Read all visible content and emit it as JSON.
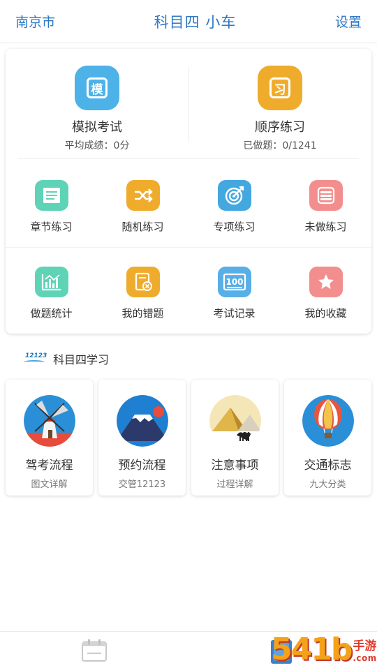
{
  "header": {
    "city": "南京市",
    "title": "科目四 小车",
    "settings": "设置"
  },
  "top_items": [
    {
      "label": "模拟考试",
      "sub": "平均成绩：0分",
      "glyph": "模",
      "color": "#4db2e8",
      "icon": "mock-exam-icon"
    },
    {
      "label": "顺序练习",
      "sub": "已做题：0/1241",
      "glyph": "习",
      "color": "#efac2c",
      "icon": "sequential-practice-icon"
    }
  ],
  "grid": [
    {
      "label": "章节练习",
      "color": "#5fd3b6",
      "icon": "chapter-practice-icon"
    },
    {
      "label": "随机练习",
      "color": "#efac2c",
      "icon": "shuffle-icon"
    },
    {
      "label": "专项练习",
      "color": "#43a7e0",
      "icon": "target-icon"
    },
    {
      "label": "未做练习",
      "color": "#f38e8e",
      "icon": "list-icon"
    },
    {
      "label": "做题统计",
      "color": "#5fd3b6",
      "icon": "statistics-icon"
    },
    {
      "label": "我的错题",
      "color": "#efac2c",
      "icon": "wrong-questions-icon"
    },
    {
      "label": "考试记录",
      "color": "#58aee6",
      "icon": "score-100-icon"
    },
    {
      "label": "我的收藏",
      "color": "#f38e8e",
      "icon": "star-icon"
    }
  ],
  "section": {
    "logo_text": "12123",
    "title": "科目四学习"
  },
  "learn_cards": [
    {
      "title": "驾考流程",
      "sub": "图文详解",
      "icon": "windmill-icon"
    },
    {
      "title": "预约流程",
      "sub": "交管12123",
      "icon": "mount-fuji-icon"
    },
    {
      "title": "注意事项",
      "sub": "过程详解",
      "icon": "pyramids-camel-icon"
    },
    {
      "title": "交通标志",
      "sub": "九大分类",
      "icon": "hot-air-balloon-icon"
    }
  ],
  "bottom_bar": {
    "tabs": [
      "calendar-icon",
      "book-icon"
    ]
  },
  "watermark": {
    "number": "54",
    "number2": "1b",
    "text": "手游网",
    "url": ".com.cn"
  }
}
